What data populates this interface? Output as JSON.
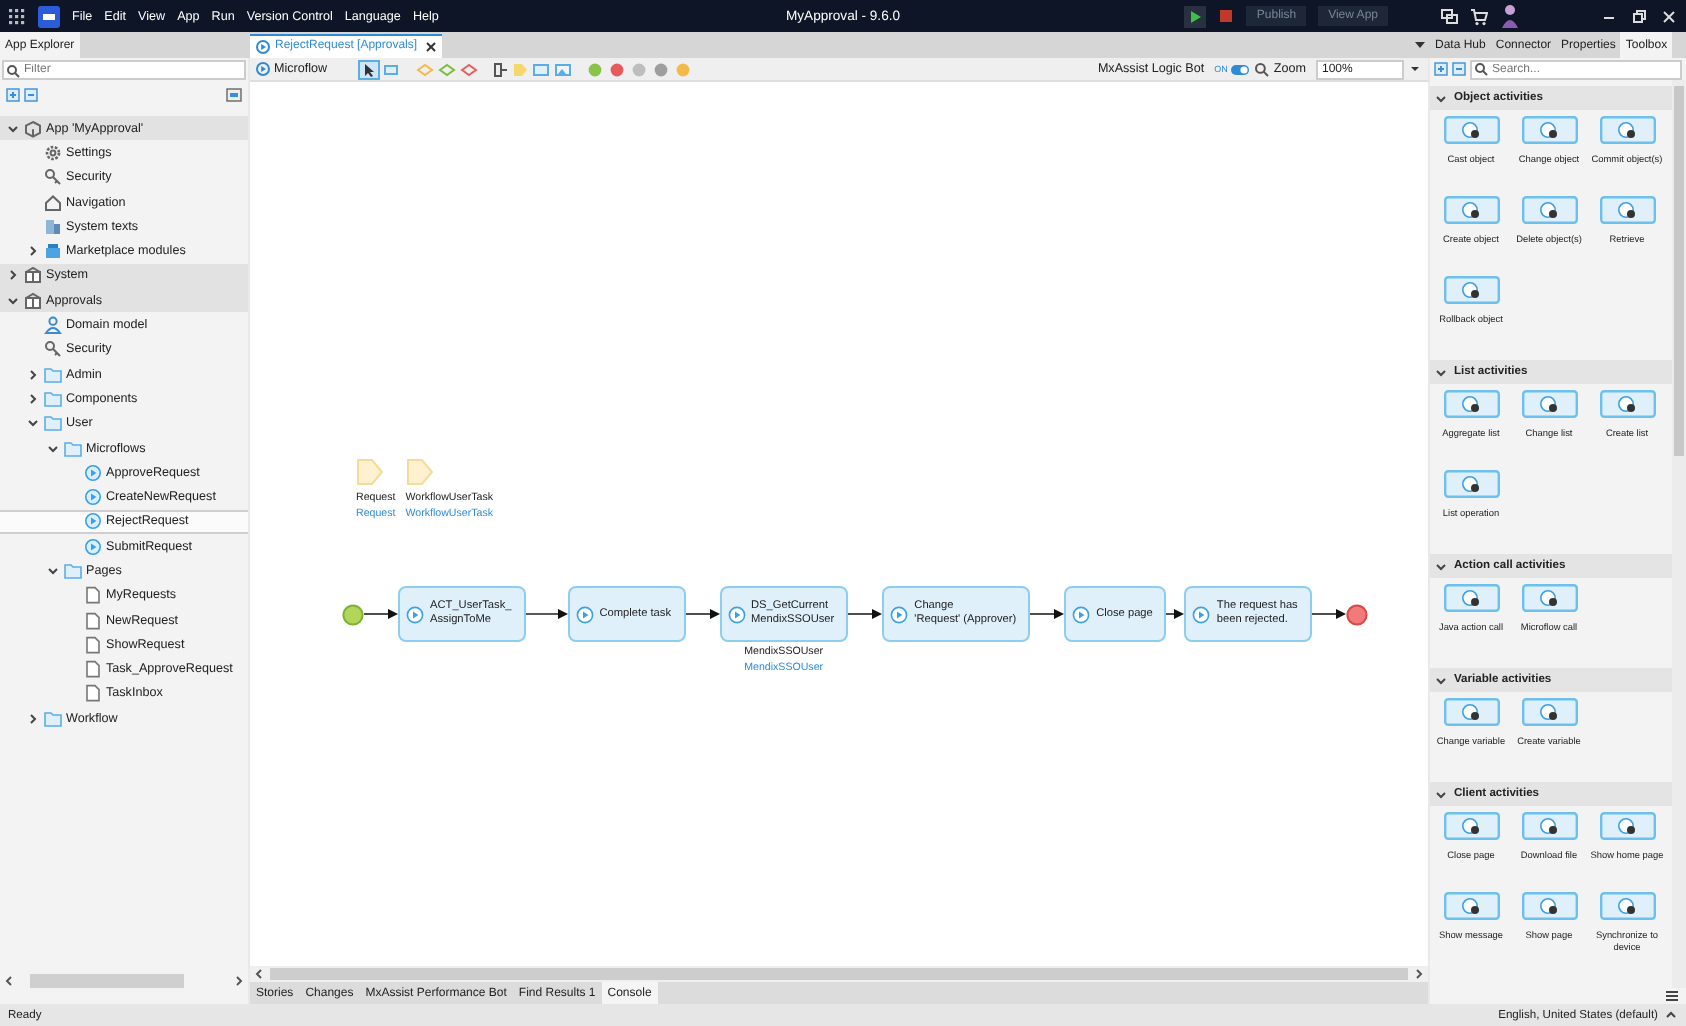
{
  "title_bar": {
    "menu": [
      "File",
      "Edit",
      "View",
      "App",
      "Run",
      "Version Control",
      "Language",
      "Help"
    ],
    "title": "MyApproval  -  9.6.0",
    "buttons": [
      "Publish",
      "View App"
    ]
  },
  "left_panel": {
    "tab": "App Explorer",
    "filter": {
      "placeholder": "Filter"
    },
    "tree": [
      {
        "label": "App 'MyApproval'",
        "kind": "app",
        "expanded": true,
        "selected": false,
        "children": [
          {
            "label": "Settings",
            "kind": "settings",
            "selected": false
          },
          {
            "label": "Security",
            "kind": "security",
            "selected": false
          },
          {
            "label": "Navigation",
            "kind": "navigation",
            "selected": false
          },
          {
            "label": "System texts",
            "kind": "texts",
            "selected": false
          },
          {
            "label": "Marketplace modules",
            "kind": "marketplace",
            "expanded": false,
            "selected": false
          }
        ]
      },
      {
        "label": "System",
        "kind": "module",
        "expanded": false,
        "selected": false
      },
      {
        "label": "Approvals",
        "kind": "module",
        "expanded": true,
        "selected": false,
        "children": [
          {
            "label": "Domain model",
            "kind": "domain",
            "selected": false
          },
          {
            "label": "Security",
            "kind": "security",
            "selected": false
          },
          {
            "label": "Admin",
            "kind": "folder",
            "expanded": false,
            "selected": false
          },
          {
            "label": "Components",
            "kind": "folder",
            "expanded": false,
            "selected": false
          },
          {
            "label": "User",
            "kind": "folder",
            "expanded": true,
            "selected": false,
            "children": [
              {
                "label": "Microflows",
                "kind": "folder",
                "expanded": true,
                "selected": false,
                "children": [
                  {
                    "label": "ApproveRequest",
                    "kind": "microflow",
                    "selected": false
                  },
                  {
                    "label": "CreateNewRequest",
                    "kind": "microflow",
                    "selected": false
                  },
                  {
                    "label": "RejectRequest",
                    "kind": "microflow",
                    "selected": true
                  },
                  {
                    "label": "SubmitRequest",
                    "kind": "microflow",
                    "selected": false
                  }
                ]
              },
              {
                "label": "Pages",
                "kind": "folder",
                "expanded": true,
                "selected": false,
                "children": [
                  {
                    "label": "MyRequests",
                    "kind": "page",
                    "selected": false
                  },
                  {
                    "label": "NewRequest",
                    "kind": "page",
                    "selected": false
                  },
                  {
                    "label": "ShowRequest",
                    "kind": "page",
                    "selected": false
                  },
                  {
                    "label": "Task_ApproveRequest",
                    "kind": "page",
                    "selected": false
                  },
                  {
                    "label": "TaskInbox",
                    "kind": "page",
                    "selected": false
                  }
                ]
              }
            ]
          },
          {
            "label": "Workflow",
            "kind": "folder",
            "expanded": false,
            "selected": false
          }
        ]
      }
    ]
  },
  "editor": {
    "tab": "RejectRequest [Approvals]",
    "toolbar": {
      "label": "Microflow",
      "bot_label": "MxAssist Logic Bot",
      "bot_toggle": {
        "text": "ON",
        "on": true
      },
      "zoom_label": "Zoom",
      "zoom_value": "100%"
    },
    "parameters": [
      {
        "name": "Request",
        "type": "Request"
      },
      {
        "name": "WorkflowUserTask",
        "type": "WorkflowUserTask"
      }
    ],
    "flow": [
      {
        "kind": "start"
      },
      {
        "kind": "activity",
        "lines": [
          "ACT_UserTask_",
          "AssignToMe"
        ]
      },
      {
        "kind": "activity",
        "lines": [
          "Complete task"
        ]
      },
      {
        "kind": "activity",
        "lines": [
          "DS_GetCurrent",
          "MendixSSOUser"
        ],
        "output": {
          "name": "MendixSSOUser",
          "type": "MendixSSOUser"
        }
      },
      {
        "kind": "activity",
        "lines": [
          "Change",
          "'Request' (Approver)"
        ]
      },
      {
        "kind": "activity",
        "lines": [
          "Close page"
        ]
      },
      {
        "kind": "activity",
        "lines": [
          "The request has",
          "been rejected."
        ]
      },
      {
        "kind": "end"
      }
    ],
    "bottom_tabs": [
      {
        "label": "Stories",
        "selected": false
      },
      {
        "label": "Changes",
        "selected": false
      },
      {
        "label": "MxAssist Performance Bot",
        "selected": false
      },
      {
        "label": "Find Results 1",
        "selected": false
      },
      {
        "label": "Console",
        "selected": true
      }
    ]
  },
  "right_panel": {
    "tabs": [
      {
        "label": "Data Hub",
        "selected": false
      },
      {
        "label": "Connector",
        "selected": false
      },
      {
        "label": "Properties",
        "selected": false
      },
      {
        "label": "Toolbox",
        "selected": true
      }
    ],
    "search": {
      "placeholder": "Search..."
    },
    "sections": [
      {
        "title": "Object activities",
        "expanded": true,
        "items": [
          {
            "label": "Cast object"
          },
          {
            "label": "Change object"
          },
          {
            "label": "Commit object(s)"
          },
          {
            "label": "Create object"
          },
          {
            "label": "Delete object(s)"
          },
          {
            "label": "Retrieve"
          },
          {
            "label": "Rollback object"
          }
        ]
      },
      {
        "title": "List activities",
        "expanded": true,
        "items": [
          {
            "label": "Aggregate list"
          },
          {
            "label": "Change list"
          },
          {
            "label": "Create list"
          },
          {
            "label": "List operation"
          }
        ]
      },
      {
        "title": "Action call activities",
        "expanded": true,
        "items": [
          {
            "label": "Java action call"
          },
          {
            "label": "Microflow call"
          }
        ]
      },
      {
        "title": "Variable activities",
        "expanded": true,
        "items": [
          {
            "label": "Change variable"
          },
          {
            "label": "Create variable"
          }
        ]
      },
      {
        "title": "Client activities",
        "expanded": true,
        "items": [
          {
            "label": "Close page"
          },
          {
            "label": "Download file"
          },
          {
            "label": "Show home page"
          },
          {
            "label": "Show message"
          },
          {
            "label": "Show page"
          },
          {
            "label": "Synchronize to device"
          }
        ]
      }
    ]
  },
  "status_bar": {
    "left": "Ready",
    "right": "English, United States (default)"
  }
}
